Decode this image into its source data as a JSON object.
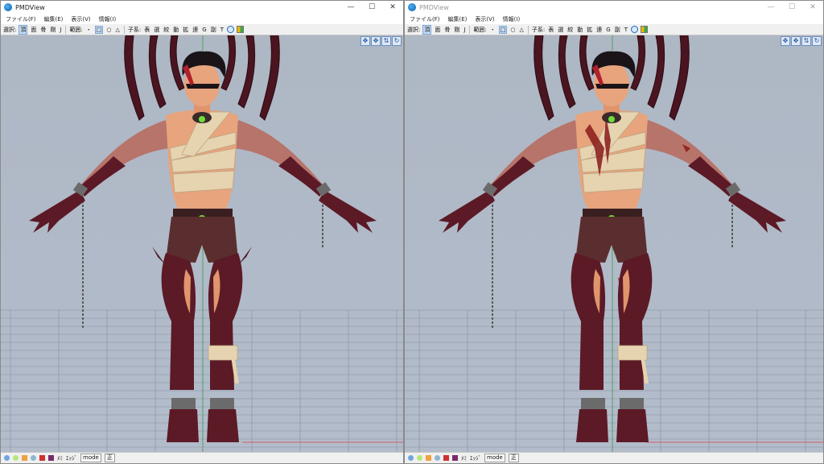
{
  "windows": [
    {
      "title": "PMDView",
      "menu": [
        "ファイル(F)",
        "編集(E)",
        "表示(V)",
        "情報(I)"
      ],
      "toolbar": {
        "select_label": "選択:",
        "select_items": [
          "頂",
          "面",
          "骨",
          "剛",
          "J"
        ],
        "range_label": "範囲:",
        "range_items": [
          "・",
          "□",
          "○",
          "△"
        ],
        "parent_label": "子系:",
        "tool_items": [
          "表",
          "選",
          "絞",
          "動",
          "拡",
          "連",
          "G",
          "副",
          "T"
        ]
      },
      "status": {
        "mat": "ﾒﾐ",
        "edge": "ｴｯｼﾞ",
        "mode": "mode",
        "positive": "正"
      },
      "inactive": false
    },
    {
      "title": "PMDView",
      "menu": [
        "ファイル(F)",
        "編集(E)",
        "表示(V)",
        "情報(I)"
      ],
      "toolbar": {
        "select_label": "選択:",
        "select_items": [
          "頂",
          "面",
          "骨",
          "剛",
          "J"
        ],
        "range_label": "範囲:",
        "range_items": [
          "・",
          "□",
          "○",
          "△"
        ],
        "parent_label": "子系:",
        "tool_items": [
          "表",
          "選",
          "絞",
          "動",
          "拡",
          "連",
          "G",
          "副",
          "T"
        ]
      },
      "status": {
        "mat": "ﾒﾐ",
        "edge": "ｴｯｼﾞ",
        "mode": "mode",
        "positive": "正"
      },
      "inactive": true
    }
  ],
  "icons": {
    "window_min": "minimize-icon",
    "window_max": "maximize-icon",
    "window_close": "close-icon",
    "nav": [
      "move-icon",
      "rotate-icon",
      "pan-icon",
      "reset-view-icon"
    ]
  },
  "colors": {
    "viewport_bg": "#b0b9c7",
    "skin": "#e7a47d",
    "demon": "#5b1a26",
    "bandage": "#e6d3b0",
    "shorts": "#5a2e2e",
    "gem": "#6fdc3a"
  }
}
